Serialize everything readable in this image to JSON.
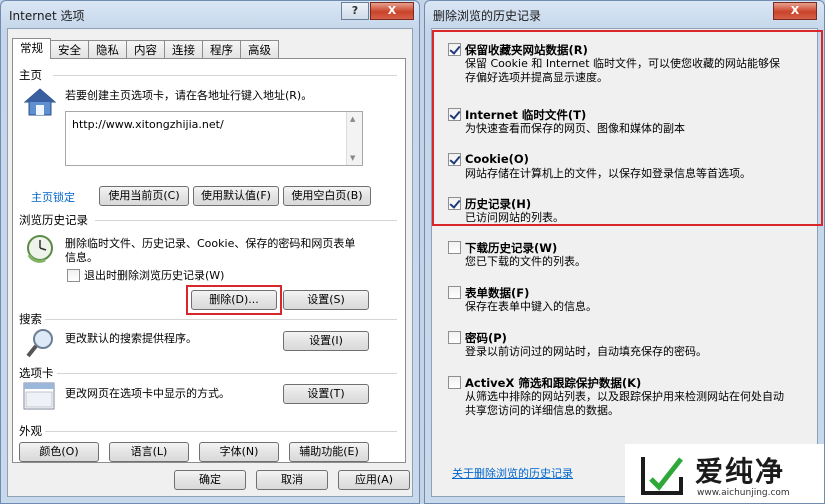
{
  "left_dialog": {
    "title": "Internet 选项",
    "title_buttons": {
      "help": "?",
      "close": "X"
    },
    "tabs": [
      "常规",
      "安全",
      "隐私",
      "内容",
      "连接",
      "程序",
      "高级"
    ],
    "home": {
      "heading": "主页",
      "description": "若要创建主页选项卡，请在各地址行键入地址(R)。",
      "url": "http://www.xitongzhijia.net/",
      "lock_link": "主页锁定",
      "buttons": [
        "使用当前页(C)",
        "使用默认值(F)",
        "使用空白页(B)"
      ]
    },
    "history": {
      "heading": "浏览历史记录",
      "description": "删除临时文件、历史记录、Cookie、保存的密码和网页表单信息。",
      "checkbox_label": "退出时删除浏览历史记录(W)",
      "checkbox_checked": false,
      "delete_button": "删除(D)...",
      "settings_button": "设置(S)"
    },
    "search": {
      "heading": "搜索",
      "description": "更改默认的搜索提供程序。",
      "settings_button": "设置(I)"
    },
    "tabs_section": {
      "heading": "选项卡",
      "description": "更改网页在选项卡中显示的方式。",
      "settings_button": "设置(T)"
    },
    "appearance": {
      "heading": "外观",
      "buttons": [
        "颜色(O)",
        "语言(L)",
        "字体(N)",
        "辅助功能(E)"
      ]
    },
    "footer_buttons": [
      "确定",
      "取消",
      "应用(A)"
    ]
  },
  "right_dialog": {
    "title": "删除浏览的历史记录",
    "close": "X",
    "items": [
      {
        "title": "保留收藏夹网站数据(R)",
        "desc": "保留 Cookie 和 Internet 临时文件，可以使您收藏的网站能够保存偏好选项并提高显示速度。",
        "checked": true
      },
      {
        "title": "Internet 临时文件(T)",
        "desc": "为快速查看而保存的网页、图像和媒体的副本",
        "checked": true
      },
      {
        "title": "Cookie(O)",
        "desc": "网站存储在计算机上的文件，以保存如登录信息等首选项。",
        "checked": true
      },
      {
        "title": "历史记录(H)",
        "desc": "已访问网站的列表。",
        "checked": true
      },
      {
        "title": "下载历史记录(W)",
        "desc": "您已下载的文件的列表。",
        "checked": false
      },
      {
        "title": "表单数据(F)",
        "desc": "保存在表单中键入的信息。",
        "checked": false
      },
      {
        "title": "密码(P)",
        "desc": "登录以前访问过的网站时，自动填充保存的密码。",
        "checked": false
      },
      {
        "title": "ActiveX 筛选和跟踪保护数据(K)",
        "desc": "从筛选中排除的网站列表，以及跟踪保护用来检测网站在何处自动共享您访问的详细信息的数据。",
        "checked": false
      }
    ],
    "about_link": "关于删除浏览的历史记录"
  },
  "watermark": {
    "text": "爱纯净",
    "url": "www.aichunjing.com"
  },
  "colors": {
    "highlight": "#d9262b",
    "link": "#0066cc"
  }
}
